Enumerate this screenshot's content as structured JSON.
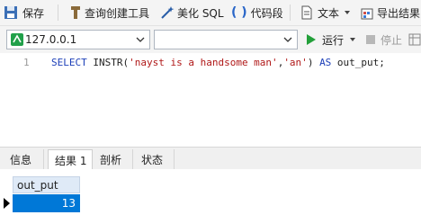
{
  "toolbar": {
    "save": "保存",
    "query_builder": "查询创建工具",
    "beautify_sql": "美化 SQL",
    "code_snippet": "代码段",
    "text": "文本",
    "export_result": "导出结果"
  },
  "connection": {
    "host": "127.0.0.1",
    "database": ""
  },
  "run_controls": {
    "run": "运行",
    "stop": "停止"
  },
  "editor": {
    "line_number": "1",
    "tokens": {
      "select_kw": "SELECT",
      "fn_name": " INSTR(",
      "arg1": "'nayst is a handsome man'",
      "comma": ",",
      "arg2": "'an'",
      "close": ") ",
      "as_kw": "AS",
      "alias": " out_put;"
    }
  },
  "result_tabs": [
    "信息",
    "结果 1",
    "剖析",
    "状态"
  ],
  "active_tab_index": 1,
  "result_grid": {
    "columns": [
      "out_put"
    ],
    "rows": [
      [
        "13"
      ]
    ]
  },
  "colors": {
    "accent": "#0078d7",
    "keyword": "#1c3fb8",
    "string": "#b01818",
    "run": "#23a03a"
  }
}
